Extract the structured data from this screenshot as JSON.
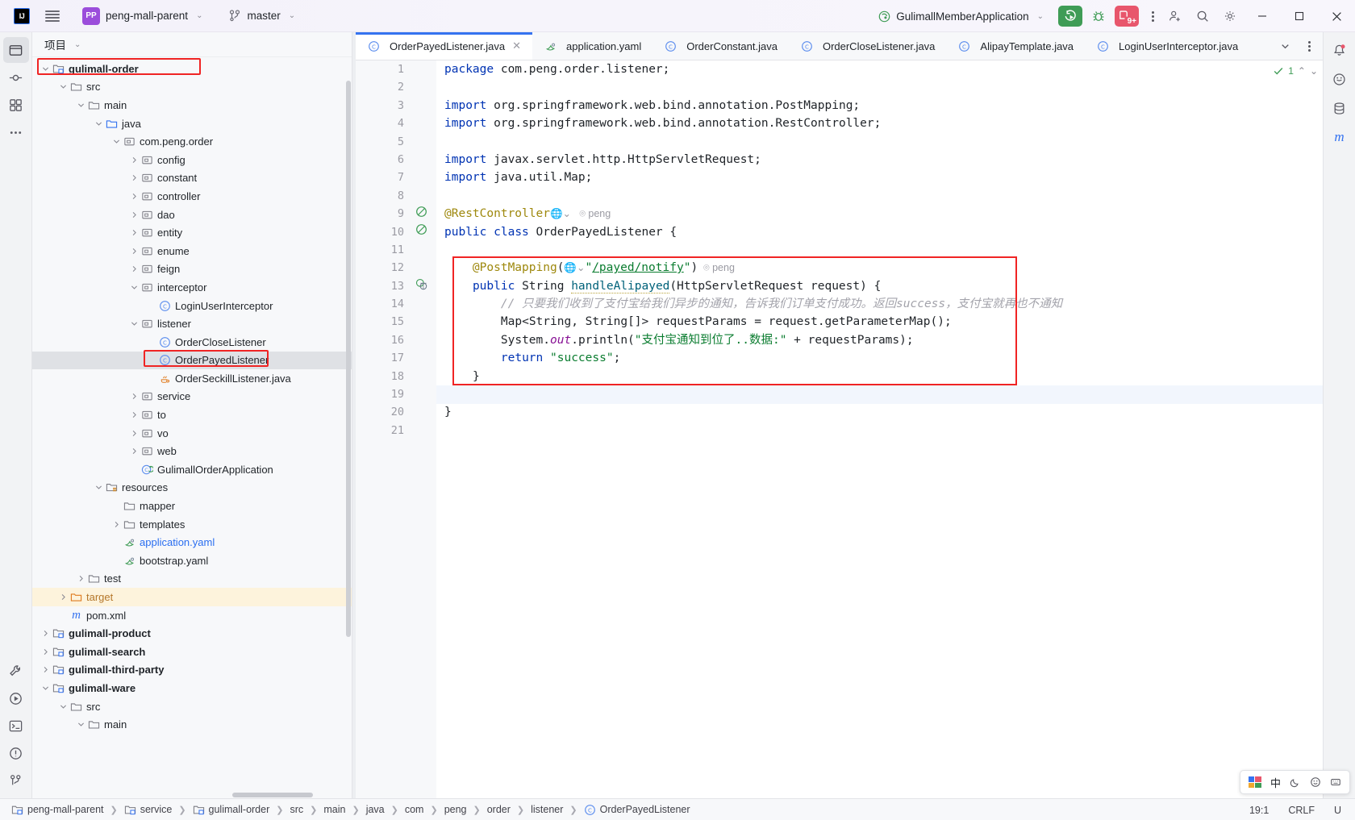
{
  "titlebar": {
    "logo_text": "IJ",
    "menu_icon": "hamburger-menu-icon",
    "project_badge": "PP",
    "project_name": "peng-mall-parent",
    "branch_icon": "git-branch-icon",
    "branch_name": "master",
    "run_config_icon": "spring-boot-icon",
    "run_config_name": "GulimallMemberApplication",
    "run_button": "run-icon",
    "debug_button": "debug-icon",
    "stop_button_count": "9+",
    "more_button": "more-vertical-icon",
    "account_icon": "account-add-icon",
    "search_icon": "search-icon",
    "settings_icon": "gear-icon",
    "minimize": "—",
    "maximize": "▢",
    "close": "✕"
  },
  "project_panel": {
    "title": "项目",
    "tree": [
      {
        "depth": 1,
        "arrow": "down",
        "icon": "module-icon",
        "label": "gulimall-order",
        "bold": true,
        "highlight": "red-box"
      },
      {
        "depth": 2,
        "arrow": "down",
        "icon": "folder-icon",
        "label": "src"
      },
      {
        "depth": 3,
        "arrow": "down",
        "icon": "folder-icon",
        "label": "main"
      },
      {
        "depth": 4,
        "arrow": "down",
        "icon": "source-root-icon",
        "label": "java"
      },
      {
        "depth": 5,
        "arrow": "down",
        "icon": "package-icon",
        "label": "com.peng.order"
      },
      {
        "depth": 6,
        "arrow": "right",
        "icon": "package-icon",
        "label": "config"
      },
      {
        "depth": 6,
        "arrow": "right",
        "icon": "package-icon",
        "label": "constant"
      },
      {
        "depth": 6,
        "arrow": "right",
        "icon": "package-icon",
        "label": "controller"
      },
      {
        "depth": 6,
        "arrow": "right",
        "icon": "package-icon",
        "label": "dao"
      },
      {
        "depth": 6,
        "arrow": "right",
        "icon": "package-icon",
        "label": "entity"
      },
      {
        "depth": 6,
        "arrow": "right",
        "icon": "package-icon",
        "label": "enume"
      },
      {
        "depth": 6,
        "arrow": "right",
        "icon": "package-icon",
        "label": "feign"
      },
      {
        "depth": 6,
        "arrow": "down",
        "icon": "package-icon",
        "label": "interceptor"
      },
      {
        "depth": 7,
        "arrow": "none",
        "icon": "java-class-icon",
        "label": "LoginUserInterceptor"
      },
      {
        "depth": 6,
        "arrow": "down",
        "icon": "package-icon",
        "label": "listener"
      },
      {
        "depth": 7,
        "arrow": "none",
        "icon": "java-class-icon",
        "label": "OrderCloseListener"
      },
      {
        "depth": 7,
        "arrow": "none",
        "icon": "java-class-icon",
        "label": "OrderPayedListener",
        "selected": true,
        "highlight": "red-box"
      },
      {
        "depth": 7,
        "arrow": "none",
        "icon": "java-file-icon",
        "label": "OrderSeckillListener.java"
      },
      {
        "depth": 6,
        "arrow": "right",
        "icon": "package-icon",
        "label": "service"
      },
      {
        "depth": 6,
        "arrow": "right",
        "icon": "package-icon",
        "label": "to"
      },
      {
        "depth": 6,
        "arrow": "right",
        "icon": "package-icon",
        "label": "vo"
      },
      {
        "depth": 6,
        "arrow": "right",
        "icon": "package-icon",
        "label": "web"
      },
      {
        "depth": 6,
        "arrow": "none",
        "icon": "spring-class-icon",
        "label": "GulimallOrderApplication"
      },
      {
        "depth": 4,
        "arrow": "down",
        "icon": "resource-root-icon",
        "label": "resources"
      },
      {
        "depth": 5,
        "arrow": "none",
        "icon": "folder-icon",
        "label": "mapper"
      },
      {
        "depth": 5,
        "arrow": "right",
        "icon": "folder-icon",
        "label": "templates"
      },
      {
        "depth": 5,
        "arrow": "none",
        "icon": "yaml-icon",
        "label": "application.yaml",
        "color": "blue"
      },
      {
        "depth": 5,
        "arrow": "none",
        "icon": "yaml-icon",
        "label": "bootstrap.yaml"
      },
      {
        "depth": 3,
        "arrow": "right",
        "icon": "folder-icon",
        "label": "test"
      },
      {
        "depth": 2,
        "arrow": "right",
        "icon": "target-folder-icon",
        "label": "target",
        "color": "orange",
        "row_highlight": "yellow"
      },
      {
        "depth": 2,
        "arrow": "none",
        "icon": "maven-icon",
        "label": "pom.xml"
      },
      {
        "depth": 1,
        "arrow": "right",
        "icon": "module-icon",
        "label": "gulimall-product",
        "bold": true
      },
      {
        "depth": 1,
        "arrow": "right",
        "icon": "module-icon",
        "label": "gulimall-search",
        "bold": true
      },
      {
        "depth": 1,
        "arrow": "right",
        "icon": "module-icon",
        "label": "gulimall-third-party",
        "bold": true
      },
      {
        "depth": 1,
        "arrow": "down",
        "icon": "module-icon",
        "label": "gulimall-ware",
        "bold": true
      },
      {
        "depth": 2,
        "arrow": "down",
        "icon": "folder-icon",
        "label": "src"
      },
      {
        "depth": 3,
        "arrow": "down",
        "icon": "folder-icon",
        "label": "main"
      }
    ]
  },
  "left_rail": [
    {
      "name": "project-tool-icon",
      "active": true
    },
    {
      "name": "commit-tool-icon",
      "active": false
    },
    {
      "name": "structure-tool-icon",
      "active": false
    },
    {
      "name": "more-tool-icon",
      "active": false
    }
  ],
  "left_rail_bottom": [
    {
      "name": "build-tool-icon"
    },
    {
      "name": "run-tool-icon"
    },
    {
      "name": "terminal-tool-icon"
    },
    {
      "name": "problems-tool-icon"
    },
    {
      "name": "git-tool-icon"
    }
  ],
  "right_rail": [
    {
      "name": "notifications-icon"
    },
    {
      "name": "ai-assistant-icon"
    },
    {
      "name": "database-icon"
    },
    {
      "name": "maven-icon"
    }
  ],
  "editor_tabs": [
    {
      "label": "OrderPayedListener.java",
      "icon": "java-class-icon",
      "active": true,
      "closable": true
    },
    {
      "label": "application.yaml",
      "icon": "yaml-icon",
      "active": false
    },
    {
      "label": "OrderConstant.java",
      "icon": "java-class-icon",
      "active": false
    },
    {
      "label": "OrderCloseListener.java",
      "icon": "java-class-icon",
      "active": false
    },
    {
      "label": "AlipayTemplate.java",
      "icon": "java-class-icon",
      "active": false
    },
    {
      "label": "LoginUserInterceptor.java",
      "icon": "java-class-icon",
      "active": false
    }
  ],
  "editor_tabs_right": {
    "list_icon": "tab-list-icon",
    "more_icon": "more-vertical-icon"
  },
  "inspection_widget": {
    "count": "1",
    "up_icon": "chevron-up-icon",
    "down_icon": "chevron-down-icon",
    "check_icon": "check-icon"
  },
  "code": {
    "line_numbers": [
      "1",
      "2",
      "3",
      "4",
      "5",
      "6",
      "7",
      "8",
      "9",
      "10",
      "11",
      "12",
      "13",
      "14",
      "15",
      "16",
      "17",
      "18",
      "19",
      "20",
      "21"
    ],
    "lines": [
      "package com.peng.order.listener;",
      "",
      "import org.springframework.web.bind.annotation.PostMapping;",
      "import org.springframework.web.bind.annotation.RestController;",
      "",
      "import javax.servlet.http.HttpServletRequest;",
      "import java.util.Map;",
      "",
      "@RestController",
      "public class OrderPayedListener {",
      "",
      "    @PostMapping(\"/payed/notify\")",
      "    public String handleAlipayed(HttpServletRequest request) {",
      "        // 只要我们收到了支付宝给我们异步的通知，告诉我们订单支付成功。返回success，支付宝就再也不通知",
      "        Map<String, String[]> requestParams = request.getParameterMap();",
      "        System.out.println(\"支付宝通知到位了..数据:\" + requestParams);",
      "        return \"success\";",
      "    }",
      "",
      "}",
      ""
    ],
    "author_hint": "peng",
    "caret_line": 19,
    "highlight_box_lines": [
      12,
      18
    ]
  },
  "statusbar": {
    "breadcrumbs": [
      {
        "label": "peng-mall-parent",
        "icon": "module-icon"
      },
      {
        "label": "service",
        "icon": "module-icon"
      },
      {
        "label": "gulimall-order",
        "icon": "module-icon"
      },
      {
        "label": "src",
        "icon": "none"
      },
      {
        "label": "main",
        "icon": "none"
      },
      {
        "label": "java",
        "icon": "none"
      },
      {
        "label": "com",
        "icon": "none"
      },
      {
        "label": "peng",
        "icon": "none"
      },
      {
        "label": "order",
        "icon": "none"
      },
      {
        "label": "listener",
        "icon": "none"
      },
      {
        "label": "OrderPayedListener",
        "icon": "java-class-icon"
      }
    ],
    "caret_position": "19:1",
    "line_separator": "CRLF",
    "encoding": "U",
    "ime_lang": "中",
    "ime_icons": [
      "keyboard-icon",
      "moon-icon",
      "emoji-icon",
      "settings-icon"
    ]
  },
  "colors": {
    "accent_blue": "#3573f0",
    "highlight_red": "#f02424",
    "run_green": "#3f9c56",
    "stop_red": "#e8566c",
    "brand_purple": "#9b4ddb",
    "string_green": "#0a7c2f",
    "keyword_blue": "#0033b3",
    "annotation_gold": "#9e880d"
  }
}
